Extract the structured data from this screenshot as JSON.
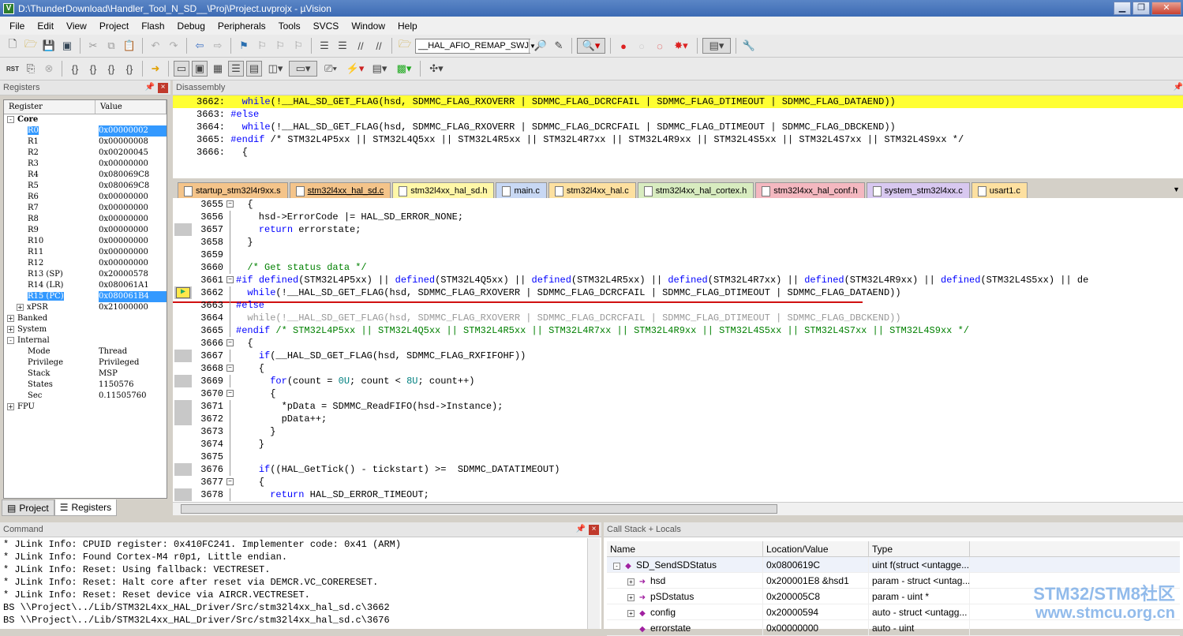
{
  "window": {
    "title": "D:\\ThunderDownload\\Handler_Tool_N_SD__\\Proj\\Project.uvprojx - µVision",
    "buttons": [
      "▁",
      "❐",
      "✕"
    ]
  },
  "menu": [
    "File",
    "Edit",
    "View",
    "Project",
    "Flash",
    "Debug",
    "Peripherals",
    "Tools",
    "SVCS",
    "Window",
    "Help"
  ],
  "toolbar": {
    "combo_value": "__HAL_AFIO_REMAP_SWJ",
    "rst_label": "RST"
  },
  "registers": {
    "title": "Registers",
    "col_register": "Register",
    "col_value": "Value",
    "rows": [
      {
        "indent": 0,
        "tree": "-",
        "name": "Core",
        "value": "",
        "bold": true
      },
      {
        "indent": 2,
        "tree": "",
        "name": "R0",
        "value": "0x00000002",
        "selected": true
      },
      {
        "indent": 2,
        "tree": "",
        "name": "R1",
        "value": "0x00000008"
      },
      {
        "indent": 2,
        "tree": "",
        "name": "R2",
        "value": "0x00200045"
      },
      {
        "indent": 2,
        "tree": "",
        "name": "R3",
        "value": "0x00000000"
      },
      {
        "indent": 2,
        "tree": "",
        "name": "R4",
        "value": "0x080069C8"
      },
      {
        "indent": 2,
        "tree": "",
        "name": "R5",
        "value": "0x080069C8"
      },
      {
        "indent": 2,
        "tree": "",
        "name": "R6",
        "value": "0x00000000"
      },
      {
        "indent": 2,
        "tree": "",
        "name": "R7",
        "value": "0x00000000"
      },
      {
        "indent": 2,
        "tree": "",
        "name": "R8",
        "value": "0x00000000"
      },
      {
        "indent": 2,
        "tree": "",
        "name": "R9",
        "value": "0x00000000"
      },
      {
        "indent": 2,
        "tree": "",
        "name": "R10",
        "value": "0x00000000"
      },
      {
        "indent": 2,
        "tree": "",
        "name": "R11",
        "value": "0x00000000"
      },
      {
        "indent": 2,
        "tree": "",
        "name": "R12",
        "value": "0x00000000"
      },
      {
        "indent": 2,
        "tree": "",
        "name": "R13 (SP)",
        "value": "0x20000578"
      },
      {
        "indent": 2,
        "tree": "",
        "name": "R14 (LR)",
        "value": "0x080061A1"
      },
      {
        "indent": 2,
        "tree": "",
        "name": "R15 (PC)",
        "value": "0x080061B4",
        "selected": true
      },
      {
        "indent": 1,
        "tree": "+",
        "name": "xPSR",
        "value": "0x21000000"
      },
      {
        "indent": 0,
        "tree": "+",
        "name": "Banked",
        "value": ""
      },
      {
        "indent": 0,
        "tree": "+",
        "name": "System",
        "value": ""
      },
      {
        "indent": 0,
        "tree": "-",
        "name": "Internal",
        "value": ""
      },
      {
        "indent": 2,
        "tree": "",
        "name": "Mode",
        "value": "Thread"
      },
      {
        "indent": 2,
        "tree": "",
        "name": "Privilege",
        "value": "Privileged"
      },
      {
        "indent": 2,
        "tree": "",
        "name": "Stack",
        "value": "MSP"
      },
      {
        "indent": 2,
        "tree": "",
        "name": "States",
        "value": "1150576"
      },
      {
        "indent": 2,
        "tree": "",
        "name": "Sec",
        "value": "0.11505760"
      },
      {
        "indent": 0,
        "tree": "+",
        "name": "FPU",
        "value": ""
      }
    ],
    "tabs": [
      "Project",
      "Registers"
    ]
  },
  "disassembly": {
    "title": "Disassembly",
    "lines": [
      {
        "text": "3662:   while(!__HAL_SD_GET_FLAG(hsd, SDMMC_FLAG_RXOVERR | SDMMC_FLAG_DCRCFAIL | SDMMC_FLAG_DTIMEOUT | SDMMC_FLAG_DATAEND))",
        "hl": true
      },
      {
        "text": "3663: #else",
        "hl": false
      },
      {
        "text": "3664:   while(!__HAL_SD_GET_FLAG(hsd, SDMMC_FLAG_RXOVERR | SDMMC_FLAG_DCRCFAIL | SDMMC_FLAG_DTIMEOUT | SDMMC_FLAG_DBCKEND))",
        "hl": false
      },
      {
        "text": "3665: #endif /* STM32L4P5xx || STM32L4Q5xx || STM32L4R5xx || STM32L4R7xx || STM32L4R9xx || STM32L4S5xx || STM32L4S7xx || STM32L4S9xx */",
        "hl": false
      },
      {
        "text": "3666:   {",
        "hl": false
      }
    ]
  },
  "file_tabs": [
    {
      "name": "startup_stm32l4r9xx.s",
      "color": "#f4c48a",
      "active": false
    },
    {
      "name": "stm32l4xx_hal_sd.c",
      "color": "#f4c48a",
      "active": true
    },
    {
      "name": "stm32l4xx_hal_sd.h",
      "color": "#fff7a8",
      "active": false
    },
    {
      "name": "main.c",
      "color": "#c8d8f4",
      "active": false
    },
    {
      "name": "stm32l4xx_hal.c",
      "color": "#fde0a0",
      "active": false
    },
    {
      "name": "stm32l4xx_hal_cortex.h",
      "color": "#d8ecc0",
      "active": false
    },
    {
      "name": "stm32l4xx_hal_conf.h",
      "color": "#f4b8c0",
      "active": false
    },
    {
      "name": "system_stm32l4xx.c",
      "color": "#d8c8f0",
      "active": false
    },
    {
      "name": "usart1.c",
      "color": "#fde0a0",
      "active": false
    }
  ],
  "editor": {
    "lines": [
      {
        "ln": "3655",
        "code": "  {",
        "mark": false
      },
      {
        "ln": "3656",
        "code": "    hsd->ErrorCode |= HAL_SD_ERROR_NONE;",
        "mark": false
      },
      {
        "ln": "3657",
        "code": "    return errorstate;",
        "mark": true
      },
      {
        "ln": "3658",
        "code": "  }",
        "mark": false
      },
      {
        "ln": "3659",
        "code": "",
        "mark": false
      },
      {
        "ln": "3660",
        "code": "  /* Get status data */",
        "mark": false
      },
      {
        "ln": "3661",
        "code": "#if defined(STM32L4P5xx) || defined(STM32L4Q5xx) || defined(STM32L4R5xx) || defined(STM32L4R7xx) || defined(STM32L4R9xx) || defined(STM32L4S5xx) || de",
        "mark": false
      },
      {
        "ln": "3662",
        "code": "  while(!__HAL_SD_GET_FLAG(hsd, SDMMC_FLAG_RXOVERR | SDMMC_FLAG_DCRCFAIL | SDMMC_FLAG_DTIMEOUT | SDMMC_FLAG_DATAEND))",
        "mark": true
      },
      {
        "ln": "3663",
        "code": "#else",
        "mark": false
      },
      {
        "ln": "3664",
        "code": "  while(!__HAL_SD_GET_FLAG(hsd, SDMMC_FLAG_RXOVERR | SDMMC_FLAG_DCRCFAIL | SDMMC_FLAG_DTIMEOUT | SDMMC_FLAG_DBCKEND))",
        "mark": false
      },
      {
        "ln": "3665",
        "code": "#endif /* STM32L4P5xx || STM32L4Q5xx || STM32L4R5xx || STM32L4R7xx || STM32L4R9xx || STM32L4S5xx || STM32L4S7xx || STM32L4S9xx */",
        "mark": false
      },
      {
        "ln": "3666",
        "code": "  {",
        "mark": false
      },
      {
        "ln": "3667",
        "code": "    if(__HAL_SD_GET_FLAG(hsd, SDMMC_FLAG_RXFIFOHF))",
        "mark": true
      },
      {
        "ln": "3668",
        "code": "    {",
        "mark": false
      },
      {
        "ln": "3669",
        "code": "      for(count = 0U; count < 8U; count++)",
        "mark": true
      },
      {
        "ln": "3670",
        "code": "      {",
        "mark": false
      },
      {
        "ln": "3671",
        "code": "        *pData = SDMMC_ReadFIFO(hsd->Instance);",
        "mark": true
      },
      {
        "ln": "3672",
        "code": "        pData++;",
        "mark": true
      },
      {
        "ln": "3673",
        "code": "      }",
        "mark": false
      },
      {
        "ln": "3674",
        "code": "    }",
        "mark": false
      },
      {
        "ln": "3675",
        "code": "",
        "mark": false
      },
      {
        "ln": "3676",
        "code": "    if((HAL_GetTick() - tickstart) >=  SDMMC_DATATIMEOUT)",
        "mark": true
      },
      {
        "ln": "3677",
        "code": "    {",
        "mark": false
      },
      {
        "ln": "3678",
        "code": "      return HAL_SD_ERROR_TIMEOUT;",
        "mark": true
      }
    ]
  },
  "command": {
    "title": "Command",
    "lines": [
      "* JLink Info: CPUID register: 0x410FC241. Implementer code: 0x41 (ARM)",
      "* JLink Info: Found Cortex-M4 r0p1, Little endian.",
      "* JLink Info: Reset: Using fallback: VECTRESET.",
      "* JLink Info: Reset: Halt core after reset via DEMCR.VC_CORERESET.",
      "* JLink Info: Reset: Reset device via AIRCR.VECTRESET.",
      "BS \\\\Project\\../Lib/STM32L4xx_HAL_Driver/Src/stm32l4xx_hal_sd.c\\3662",
      "BS \\\\Project\\../Lib/STM32L4xx_HAL_Driver/Src/stm32l4xx_hal_sd.c\\3676"
    ]
  },
  "callstack": {
    "title": "Call Stack + Locals",
    "columns": [
      "Name",
      "Location/Value",
      "Type"
    ],
    "rows": [
      {
        "exp": "-",
        "icon": "◆",
        "name": "SD_SendSDStatus",
        "value": "0x0800619C",
        "type": "uint f(struct <untagge...",
        "indent": 0
      },
      {
        "exp": "+",
        "icon": "➜",
        "name": "hsd",
        "value": "0x200001E8 &hsd1",
        "type": "param - struct <untag...",
        "indent": 1
      },
      {
        "exp": "+",
        "icon": "➜",
        "name": "pSDstatus",
        "value": "0x200005C8",
        "type": "param - uint *",
        "indent": 1
      },
      {
        "exp": "+",
        "icon": "◆",
        "name": "config",
        "value": "0x20000594",
        "type": "auto - struct <untagg...",
        "indent": 1
      },
      {
        "exp": "",
        "icon": "◆",
        "name": "errorstate",
        "value": "0x00000000",
        "type": "auto - uint",
        "indent": 1
      }
    ]
  },
  "watermark": {
    "line1": "STM32/STM8社区",
    "line2": "www.stmcu.org.cn"
  }
}
